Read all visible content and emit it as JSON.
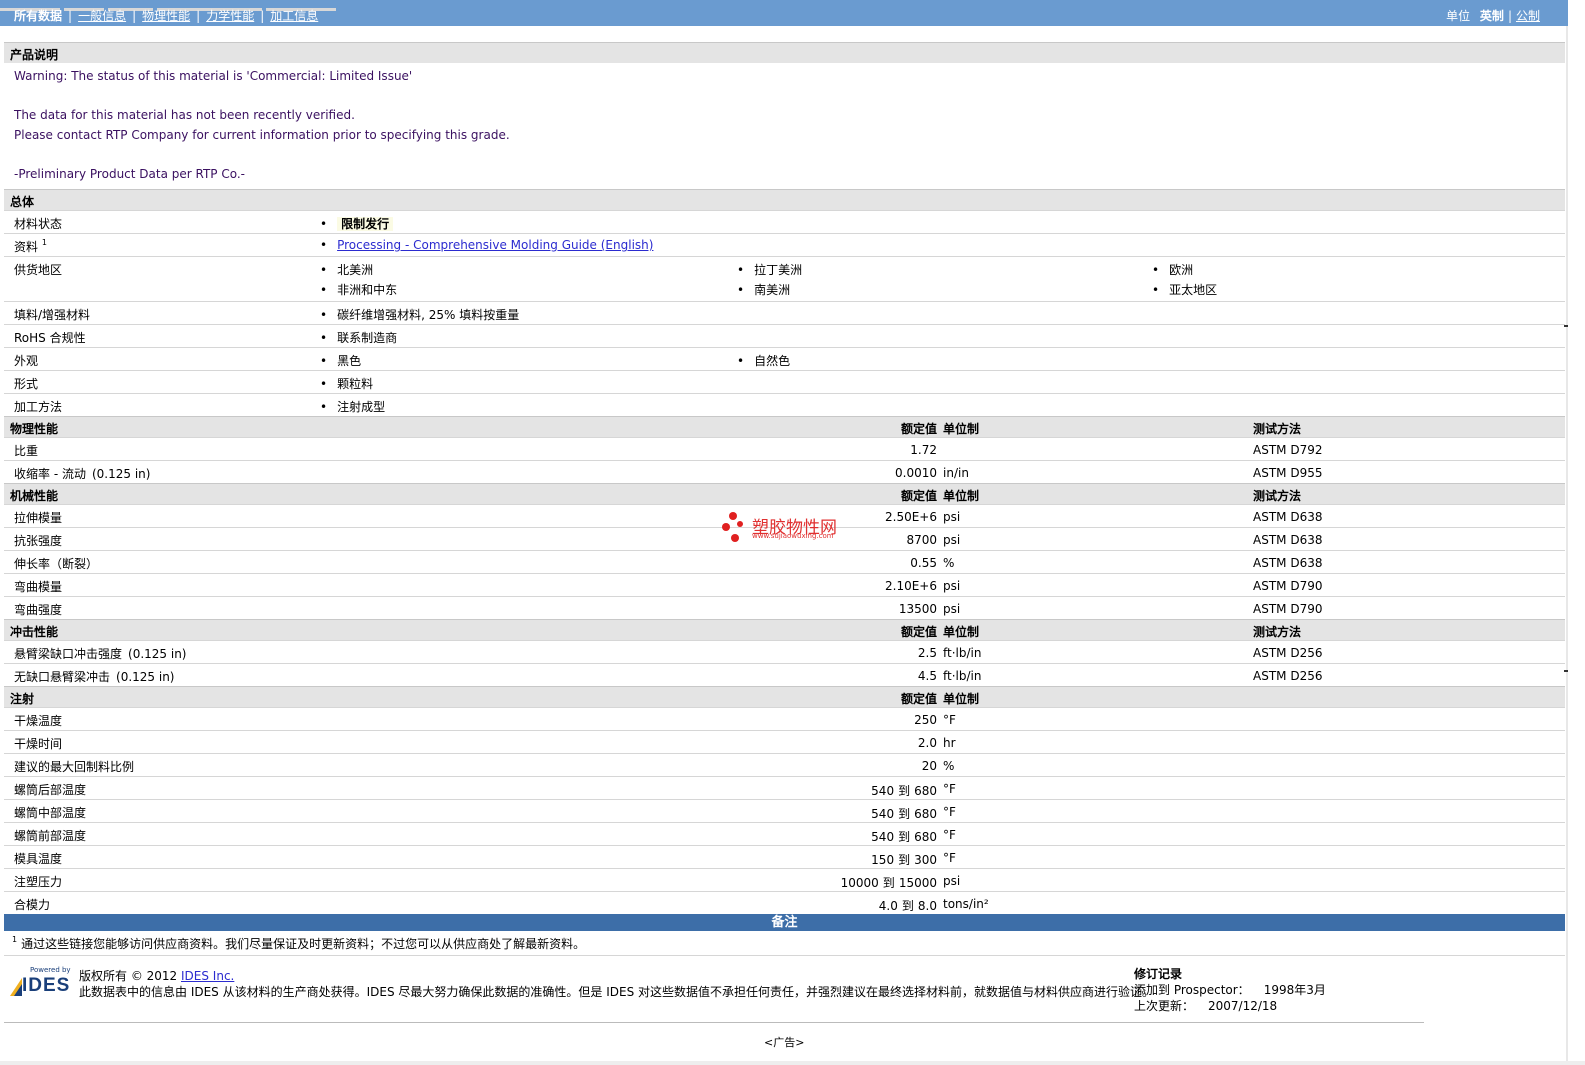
{
  "nav": {
    "tabs": [
      {
        "label": "所有数据"
      },
      {
        "label": "一般信息"
      },
      {
        "label": "物理性能"
      },
      {
        "label": "力学性能"
      },
      {
        "label": "加工信息"
      }
    ],
    "units_label": "单位",
    "unit_english": "英制",
    "unit_metric": "公制"
  },
  "product_description": {
    "title": "产品说明",
    "lines": [
      "Warning: The status of this material is 'Commercial: Limited Issue'",
      "",
      "The data for this material has not been recently verified.",
      "Please contact RTP Company for current information prior to specifying this grade.",
      "",
      "-Preliminary Product Data per RTP Co.-"
    ]
  },
  "general": {
    "title": "总体",
    "material_status": {
      "label": "材料状态",
      "value": "限制发行"
    },
    "literature": {
      "label": "资料",
      "sup": "1",
      "link": "Processing - Comprehensive Molding Guide (English)"
    },
    "availability": {
      "label": "供货地区",
      "values": [
        "北美洲",
        "拉丁美洲",
        "欧洲",
        "非洲和中东",
        "南美洲",
        "亚太地区"
      ]
    },
    "filler": {
      "label": "填料/增强材料",
      "value": "碳纤维增强材料, 25% 填料按重量"
    },
    "rohs": {
      "label": "RoHS 合规性",
      "value": "联系制造商"
    },
    "appearance": {
      "label": "外观",
      "values": [
        "黑色",
        "自然色"
      ]
    },
    "forms": {
      "label": "形式",
      "value": "颗粒料"
    },
    "processing": {
      "label": "加工方法",
      "value": "注射成型"
    }
  },
  "column_headers": {
    "nominal": "额定值",
    "unit": "单位制",
    "test": "测试方法"
  },
  "physical": {
    "title": "物理性能",
    "rows": [
      {
        "label": "比重",
        "mod": "",
        "value": "1.72",
        "unit": "",
        "test": "ASTM D792"
      },
      {
        "label": "收缩率 - 流动",
        "mod": "(0.125 in)",
        "value": "0.0010",
        "unit": "in/in",
        "test": "ASTM D955"
      }
    ]
  },
  "mechanical": {
    "title": "机械性能",
    "rows": [
      {
        "label": "拉伸模量",
        "value": "2.50E+6",
        "unit": "psi",
        "test": "ASTM D638"
      },
      {
        "label": "抗张强度",
        "value": "8700",
        "unit": "psi",
        "test": "ASTM D638"
      },
      {
        "label": "伸长率（断裂）",
        "value": "0.55",
        "unit": "%",
        "test": "ASTM D638"
      },
      {
        "label": "弯曲模量",
        "value": "2.10E+6",
        "unit": "psi",
        "test": "ASTM D790"
      },
      {
        "label": "弯曲强度",
        "value": "13500",
        "unit": "psi",
        "test": "ASTM D790"
      }
    ]
  },
  "impact": {
    "title": "冲击性能",
    "rows": [
      {
        "label": "悬臂梁缺口冲击强度",
        "mod": "(0.125 in)",
        "value": "2.5",
        "unit": "ft·lb/in",
        "test": "ASTM D256"
      },
      {
        "label": "无缺口悬臂梁冲击",
        "mod": "(0.125 in)",
        "value": "4.5",
        "unit": "ft·lb/in",
        "test": "ASTM D256"
      }
    ]
  },
  "injection": {
    "title": "注射",
    "to": "到",
    "rows": [
      {
        "label": "干燥温度",
        "value": "250",
        "unit": "°F"
      },
      {
        "label": "干燥时间",
        "value": "2.0",
        "unit": "hr"
      },
      {
        "label": "建议的最大回制料比例",
        "value": "20",
        "unit": "%"
      },
      {
        "label": "螺筒后部温度",
        "from": "540",
        "upto": "680",
        "unit": "°F"
      },
      {
        "label": "螺筒中部温度",
        "from": "540",
        "upto": "680",
        "unit": "°F"
      },
      {
        "label": "螺筒前部温度",
        "from": "540",
        "upto": "680",
        "unit": "°F"
      },
      {
        "label": "模具温度",
        "from": "150",
        "upto": "300",
        "unit": "°F"
      },
      {
        "label": "注塑压力",
        "from": "10000",
        "upto": "15000",
        "unit": "psi"
      },
      {
        "label": "合模力",
        "from": "4.0",
        "upto": "8.0",
        "unit": "tons/in²"
      }
    ]
  },
  "notes": {
    "title": "备注",
    "sup": "1",
    "footnote": "通过这些链接您能够访问供应商资料。我们尽量保证及时更新资料；不过您可以从供应商处了解最新资料。"
  },
  "footer": {
    "logo_powered": "Powered by",
    "logo_text": "IDES",
    "copyright": "版权所有 © 2012",
    "copyright_link": "IDES Inc.",
    "disclaimer": "此数据表中的信息由 IDES 从该材料的生产商处获得。IDES 尽最大努力确保此数据的准确性。但是 IDES 对这些数据值不承担任何责任，并强烈建议在最终选择材料前，就数据值与材料供应商进行验证。",
    "revision_title": "修订记录",
    "added_label": "添加到 Prospector：",
    "added_value": "1998年3月",
    "updated_label": "上次更新：",
    "updated_value": "2007/12/18"
  },
  "watermark": {
    "name": "塑胶物性网",
    "url": "www.sujiaowuxing.com"
  },
  "ad": "<广告>"
}
